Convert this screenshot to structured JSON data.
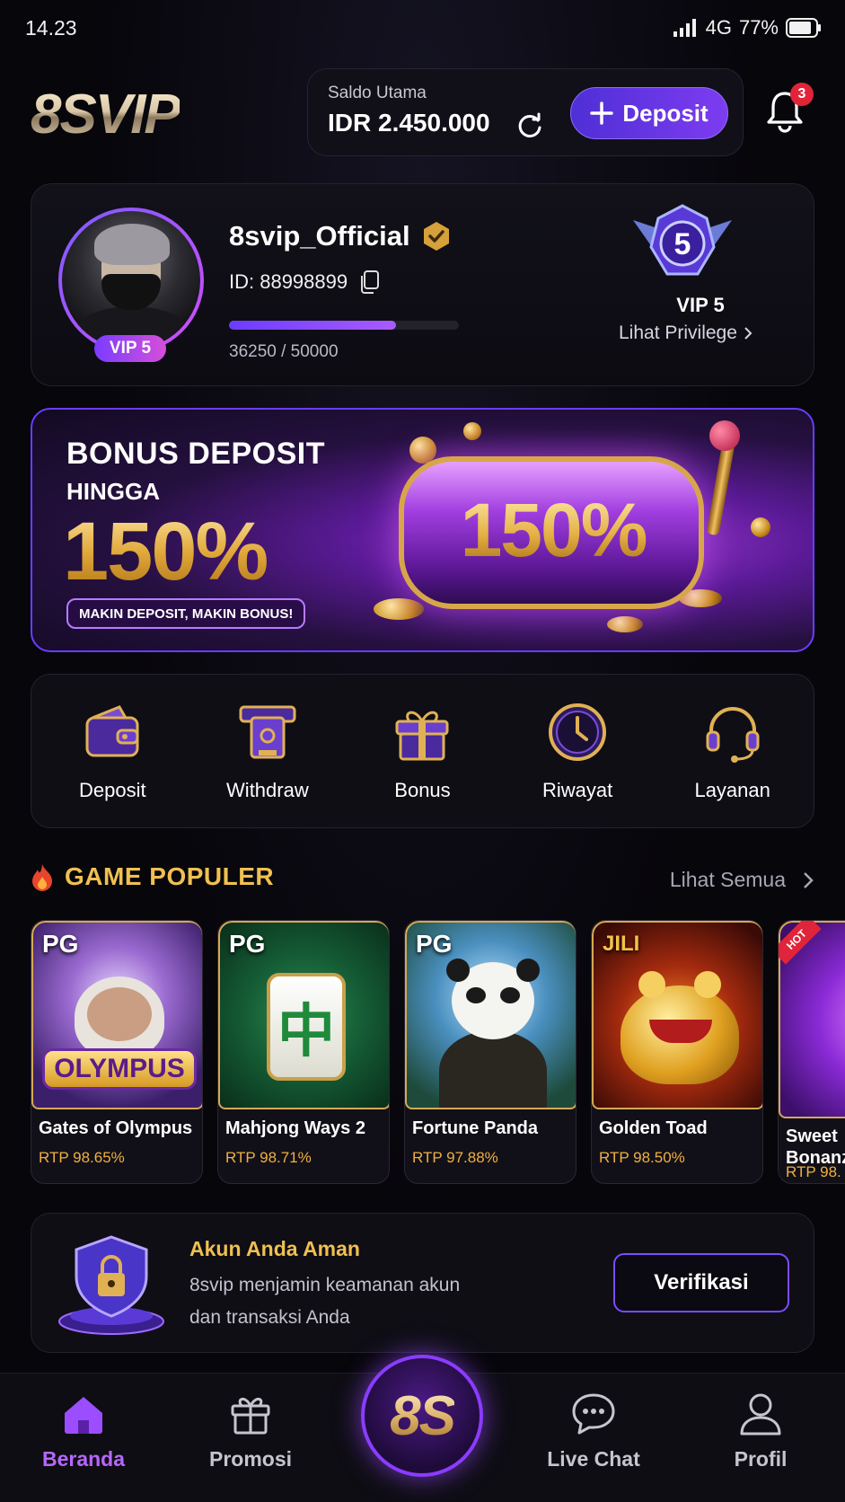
{
  "status_bar": {
    "time": "14.23",
    "network": "4G",
    "battery": "77%"
  },
  "header": {
    "logo": "8SVIP",
    "balance_label": "Saldo Utama",
    "balance_amount": "IDR 2.450.000",
    "deposit_label": "Deposit",
    "notification_count": "3"
  },
  "profile": {
    "username": "8svip_Official",
    "user_id": "ID: 88998899",
    "vip_pill": "VIP 5",
    "xp_text": "36250 / 50000",
    "xp_progress": 0.725,
    "vip_level_number": "5",
    "vip_level_label": "VIP 5",
    "privilege_link": "Lihat Privilege"
  },
  "banner": {
    "title": "BONUS DEPOSIT",
    "subtitle": "HINGGA",
    "percent": "150%",
    "slot_text": "150%",
    "tagline": "MAKIN DEPOSIT, MAKIN BONUS!"
  },
  "quick_menu": [
    {
      "label": "Deposit",
      "icon": "wallet-icon"
    },
    {
      "label": "Withdraw",
      "icon": "atm-icon"
    },
    {
      "label": "Bonus",
      "icon": "gift-icon"
    },
    {
      "label": "Riwayat",
      "icon": "clock-icon"
    },
    {
      "label": "Layanan",
      "icon": "headset-icon"
    }
  ],
  "popular": {
    "title": "GAME POPULER",
    "see_all": "Lihat Semua",
    "games": [
      {
        "provider": "PG",
        "name": "Gates of Olympus",
        "rtp": "RTP 98.65%",
        "art": "OLYMPUS"
      },
      {
        "provider": "PG",
        "name": "Mahjong Ways 2",
        "rtp": "RTP 98.71%",
        "art": "中"
      },
      {
        "provider": "PG",
        "name": "Fortune Panda",
        "rtp": "RTP 97.88%",
        "art": ""
      },
      {
        "provider": "JILI",
        "name": "Golden Toad",
        "rtp": "RTP 98.50%",
        "art": ""
      },
      {
        "provider": "",
        "name": "Sweet Bonanza",
        "rtp": "RTP 98.",
        "hot": "HOT"
      }
    ]
  },
  "security": {
    "title": "Akun Anda Aman",
    "desc_line1": "8svip menjamin keamanan akun",
    "desc_line2": "dan transaksi Anda",
    "button": "Verifikasi"
  },
  "bottom_nav": {
    "items": [
      {
        "label": "Beranda"
      },
      {
        "label": "Promosi"
      },
      {
        "label": "Live Chat"
      },
      {
        "label": "Profil"
      }
    ],
    "center_logo": "8S"
  },
  "colors": {
    "accent": "#8a3cff",
    "gold": "#f0c050",
    "background": "#07060b"
  }
}
